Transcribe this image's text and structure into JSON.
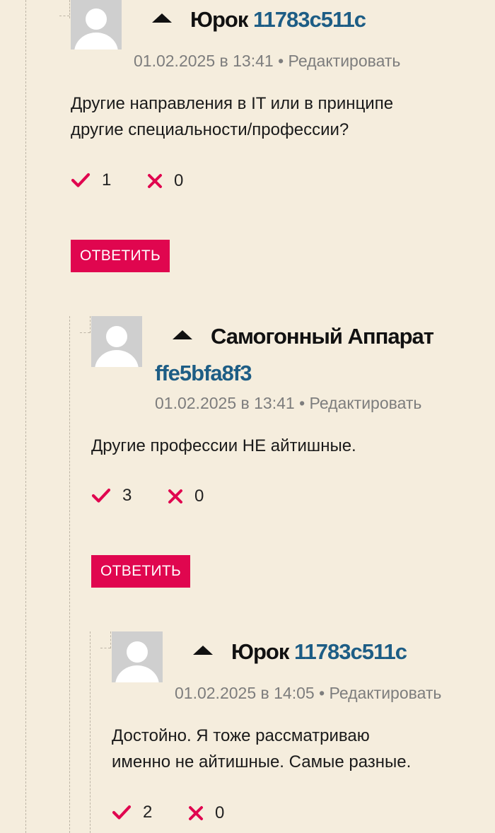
{
  "comments": [
    {
      "author": "Юрок",
      "user_id": "11783c511c",
      "datetime": "01.02.2025 в 13:41",
      "separator": "•",
      "edit_label": "Редактировать",
      "text_lines": [
        "Другие направления в IT или в принципе",
        "другие специальности/профессии?"
      ],
      "upvotes": "1",
      "downvotes": "0",
      "reply_label": "ОТВЕТИТЬ"
    },
    {
      "author": "Самогонный Аппарат",
      "user_id": "ffe5bfa8f3",
      "datetime": "01.02.2025 в 13:41",
      "separator": "•",
      "edit_label": "Редактировать",
      "text_lines": [
        "Другие профессии НЕ айтишные."
      ],
      "upvotes": "3",
      "downvotes": "0",
      "reply_label": "ОТВЕТИТЬ"
    },
    {
      "author": "Юрок",
      "user_id": "11783c511c",
      "datetime": "01.02.2025 в 14:05",
      "separator": "•",
      "edit_label": "Редактировать",
      "text_lines": [
        "Достойно. Я тоже рассматриваю",
        "именно не айтишные. Самые разные."
      ],
      "upvotes": "2",
      "downvotes": "0"
    }
  ],
  "icons": {
    "collapse": "triangle-up-icon",
    "upvote": "checkmark-icon",
    "downvote": "cross-icon",
    "avatar": "default-user-avatar"
  },
  "colors": {
    "background": "#f5eddd",
    "accent": "#e0064f",
    "user_id": "#1d5d85",
    "meta": "#7d7d7d"
  }
}
